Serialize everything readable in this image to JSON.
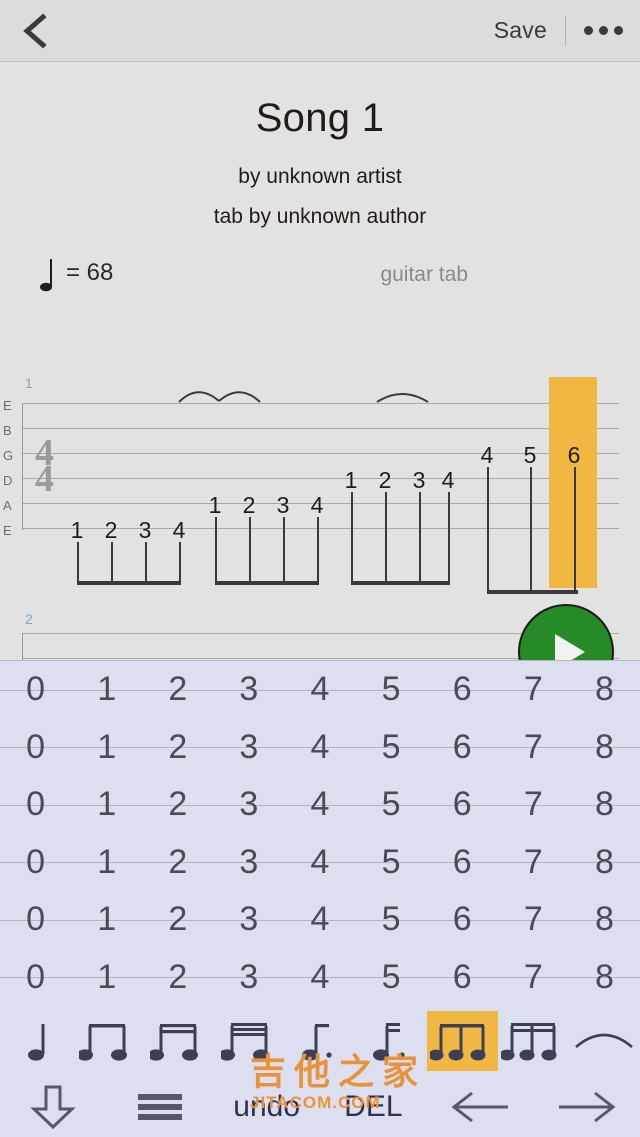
{
  "topbar": {
    "back_icon": "chevron-left-icon",
    "save_label": "Save",
    "more_icon": "more-horizontal-icon"
  },
  "score": {
    "title": "Song 1",
    "artist": "by unknown artist",
    "author": "tab by unknown author",
    "tempo_note_icon": "quarter-note-icon",
    "tempo_value": "= 68",
    "track_name": "guitar tab",
    "time_signature": {
      "numerator": "4",
      "denominator": "4"
    },
    "string_labels": [
      "E",
      "B",
      "G",
      "D",
      "A",
      "E"
    ],
    "measures": [
      {
        "number": "1"
      },
      {
        "number": "2"
      }
    ],
    "note_groups": [
      {
        "frets": [
          "1",
          "2",
          "3",
          "4"
        ],
        "string_index": 5
      },
      {
        "frets": [
          "1",
          "2",
          "3",
          "4"
        ],
        "string_index": 4
      },
      {
        "frets": [
          "1",
          "2",
          "3",
          "4"
        ],
        "string_index": 3
      },
      {
        "frets": [
          "4",
          "5",
          "6"
        ],
        "string_index": 2
      }
    ],
    "cursor_fret": "6",
    "cursor_color": "#f0b743",
    "play_button_color": "#268b26",
    "play_icon": "play-icon"
  },
  "keypad": {
    "columns": [
      "0",
      "1",
      "2",
      "3",
      "4",
      "5",
      "6",
      "7",
      "8"
    ],
    "rows": 6,
    "background": "#dcdff0"
  },
  "duration_toolbar": {
    "selected_index": 6,
    "buttons": [
      {
        "name": "quarter-note-icon",
        "label": "quarter note"
      },
      {
        "name": "eighth-note-pair-icon",
        "label": "eighth notes"
      },
      {
        "name": "sixteenth-note-pair-icon",
        "label": "sixteenth notes"
      },
      {
        "name": "thirtysecond-note-pair-icon",
        "label": "thirty-second notes"
      },
      {
        "name": "dotted-eighth-note-icon",
        "label": "dotted eighth note"
      },
      {
        "name": "dotted-sixteenth-note-icon",
        "label": "dotted sixteenth note"
      },
      {
        "name": "eighth-note-triplet-icon",
        "label": "eighth note triplet"
      },
      {
        "name": "sixteenth-note-triplet-icon",
        "label": "sixteenth note triplet"
      },
      {
        "name": "tie-slur-icon",
        "label": "tie"
      }
    ]
  },
  "action_bar": {
    "buttons": [
      {
        "name": "download-arrow-icon",
        "label": ""
      },
      {
        "name": "hamburger-menu-icon",
        "label": ""
      },
      {
        "name": "undo-button",
        "label": "undo"
      },
      {
        "name": "delete-button",
        "label": "DEL"
      },
      {
        "name": "arrow-left-icon",
        "label": ""
      },
      {
        "name": "arrow-right-icon",
        "label": ""
      }
    ]
  },
  "watermark": {
    "main": "吉他之家",
    "sub": "JITACOM.COM"
  }
}
